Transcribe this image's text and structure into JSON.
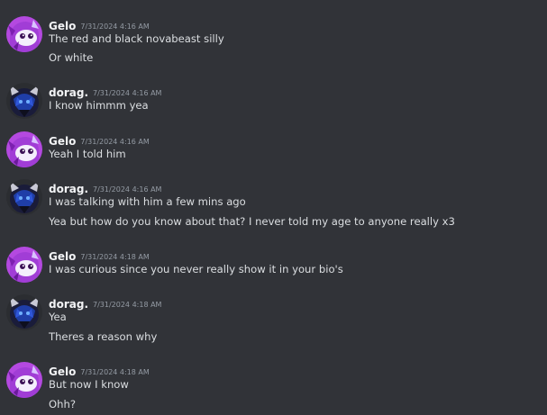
{
  "colors": {
    "background": "#313338",
    "username": "#f2f3f5",
    "timestamp": "#949ba4",
    "message_text": "#dbdee1",
    "gelo_avatar_main": "#a13dd6",
    "dorag_avatar_main": "#1f3ea8"
  },
  "messages": [
    {
      "author": "Gelo",
      "avatar_icon": "purple-white-creature-avatar-icon",
      "timestamp": "7/31/2024 4:16 AM",
      "lines": [
        "The red and black novabeast silly",
        "Or white"
      ]
    },
    {
      "author": "dorag.",
      "avatar_icon": "dark-blue-creature-avatar-icon",
      "timestamp": "7/31/2024 4:16 AM",
      "lines": [
        "I know himmm yea"
      ]
    },
    {
      "author": "Gelo",
      "avatar_icon": "purple-white-creature-avatar-icon",
      "timestamp": "7/31/2024 4:16 AM",
      "lines": [
        "Yeah I told him"
      ]
    },
    {
      "author": "dorag.",
      "avatar_icon": "dark-blue-creature-avatar-icon",
      "timestamp": "7/31/2024 4:16 AM",
      "lines": [
        "I was talking with him a few mins ago",
        "Yea but how do you know about that? I never told my age to anyone really x3"
      ]
    },
    {
      "author": "Gelo",
      "avatar_icon": "purple-white-creature-avatar-icon",
      "timestamp": "7/31/2024 4:18 AM",
      "lines": [
        "I was curious since you never really show it in your bio's"
      ]
    },
    {
      "author": "dorag.",
      "avatar_icon": "dark-blue-creature-avatar-icon",
      "timestamp": "7/31/2024 4:18 AM",
      "lines": [
        "Yea",
        "Theres a reason why"
      ]
    },
    {
      "author": "Gelo",
      "avatar_icon": "purple-white-creature-avatar-icon",
      "timestamp": "7/31/2024 4:18 AM",
      "lines": [
        "But now I know",
        "Ohh?"
      ]
    }
  ]
}
